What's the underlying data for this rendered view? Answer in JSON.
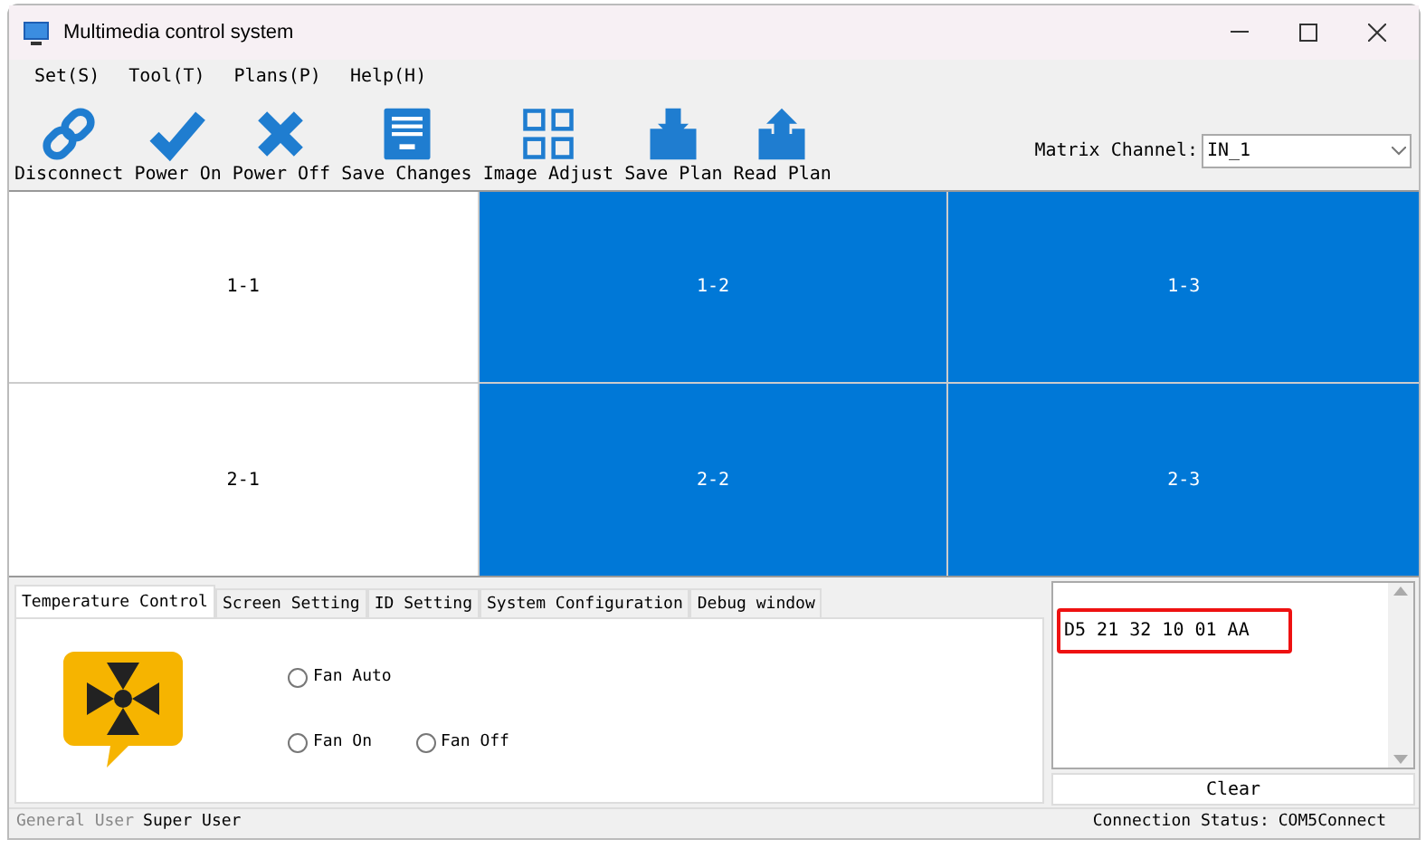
{
  "window": {
    "title": "Multimedia control system"
  },
  "menu": [
    "Set(S)",
    "Tool(T)",
    "Plans(P)",
    "Help(H)"
  ],
  "toolbar": [
    {
      "label": "Disconnect"
    },
    {
      "label": "Power On"
    },
    {
      "label": "Power Off"
    },
    {
      "label": "Save Changes"
    },
    {
      "label": "Image Adjust"
    },
    {
      "label": "Save Plan"
    },
    {
      "label": "Read Plan"
    }
  ],
  "matrix_channel": {
    "label": "Matrix Channel:",
    "value": "IN_1"
  },
  "screens": [
    [
      {
        "label": "1-1",
        "selected": false
      },
      {
        "label": "1-2",
        "selected": true
      },
      {
        "label": "1-3",
        "selected": true
      }
    ],
    [
      {
        "label": "2-1",
        "selected": false
      },
      {
        "label": "2-2",
        "selected": true
      },
      {
        "label": "2-3",
        "selected": true
      }
    ]
  ],
  "tabs": [
    {
      "label": "Temperature Control",
      "selected": true
    },
    {
      "label": "Screen Setting",
      "selected": false
    },
    {
      "label": "ID Setting",
      "selected": false
    },
    {
      "label": "System Configuration",
      "selected": false
    },
    {
      "label": "Debug window",
      "selected": false
    }
  ],
  "fan_options": [
    [
      {
        "label": "Fan Auto",
        "checked": false
      }
    ],
    [
      {
        "label": "Fan On",
        "checked": false
      },
      {
        "label": "Fan Off",
        "checked": false
      }
    ]
  ],
  "debug_log": {
    "text": "D5 21 32 10 01 AA",
    "highlighted": true
  },
  "clear_button": "Clear",
  "status_bar": {
    "user_label": "General User",
    "user": "Super User",
    "connection_label": "Connection Status:",
    "connection": "COM5Connect"
  }
}
